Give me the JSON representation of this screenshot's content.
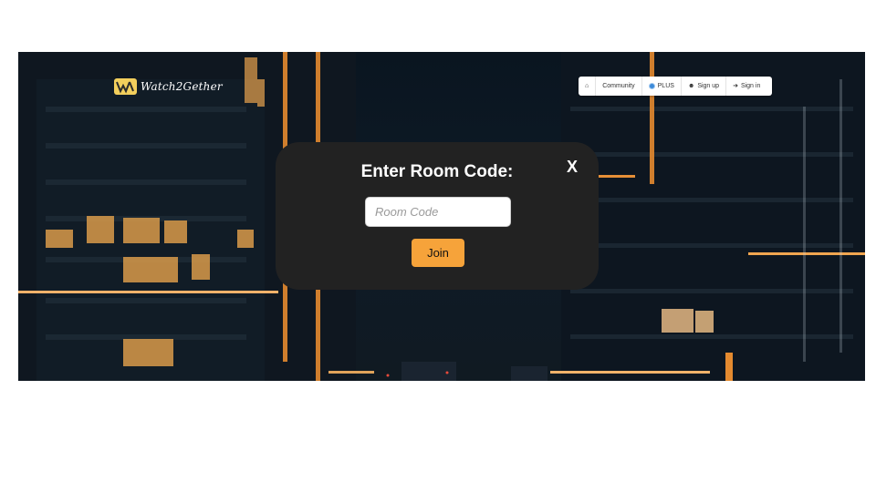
{
  "brand": {
    "logo_text": "Watch2Gether",
    "logo_icon": "w2g-logo-icon"
  },
  "nav": [
    {
      "label": "",
      "icon": "home-icon"
    },
    {
      "label": "Community",
      "icon": ""
    },
    {
      "label": "PLUS",
      "icon": "plus-circle-icon"
    },
    {
      "label": "Sign up",
      "icon": "user-plus-icon"
    },
    {
      "label": "Sign in",
      "icon": "sign-in-icon"
    }
  ],
  "modal": {
    "title": "Enter Room Code:",
    "close_label": "X",
    "input": {
      "placeholder": "Room Code",
      "value": ""
    },
    "join_label": "Join"
  },
  "colors": {
    "modal_bg": "#222222",
    "accent": "#f6a33a",
    "hero_bg": "#0e1b27"
  }
}
